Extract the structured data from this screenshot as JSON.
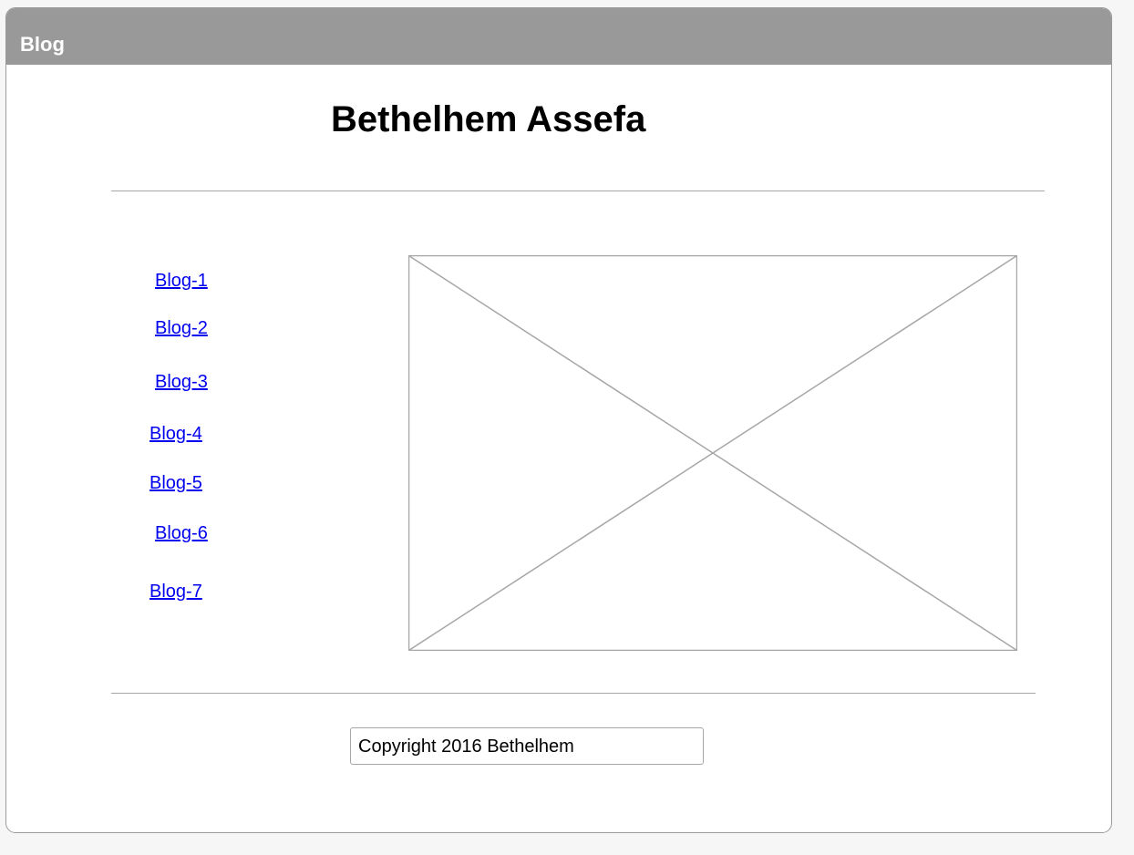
{
  "window": {
    "title": "Blog"
  },
  "header": {
    "title": "Bethelhem Assefa"
  },
  "sidebar": {
    "links": [
      {
        "label": "Blog-1"
      },
      {
        "label": "Blog-2"
      },
      {
        "label": "Blog-3"
      },
      {
        "label": "Blog-4"
      },
      {
        "label": "Blog-5"
      },
      {
        "label": "Blog-6"
      },
      {
        "label": "Blog-7"
      }
    ]
  },
  "main": {
    "image_placeholder": "image-placeholder-icon"
  },
  "footer": {
    "copyright": "Copyright 2016 Bethelhem"
  },
  "colors": {
    "titlebar": "#999999",
    "link": "#0000ee",
    "border": "#a6a6a6",
    "background": "#ffffff"
  }
}
